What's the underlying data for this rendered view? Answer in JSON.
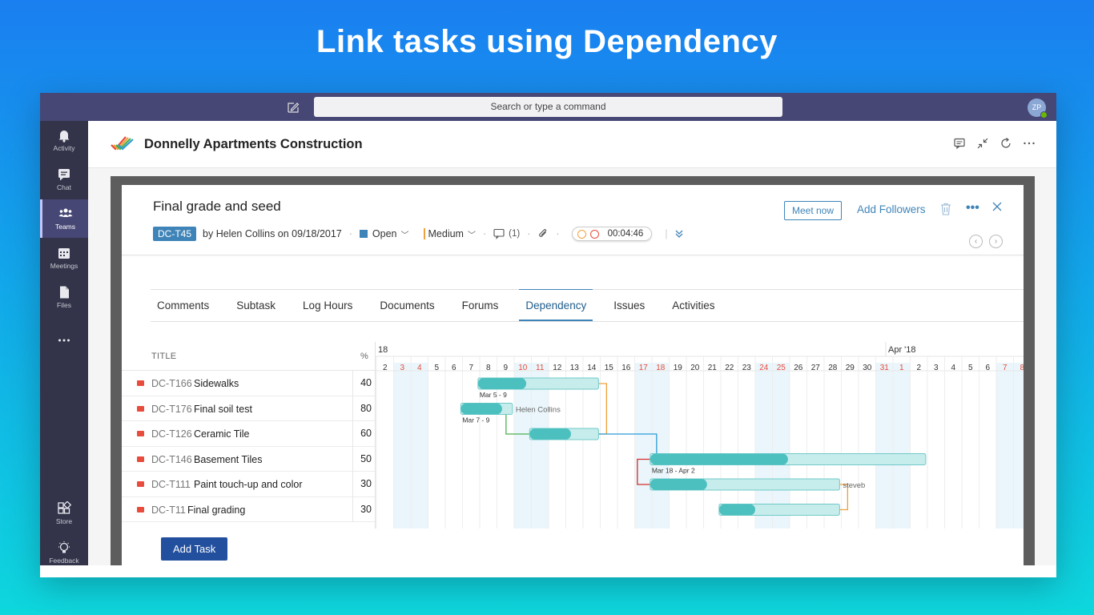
{
  "headline": "Link tasks using Dependency",
  "titlebar": {
    "search_placeholder": "Search or type a command",
    "avatar_initials": "ZP"
  },
  "rail": [
    {
      "label": "Activity",
      "icon": "bell-icon",
      "active": false
    },
    {
      "label": "Chat",
      "icon": "chat-icon",
      "active": false
    },
    {
      "label": "Teams",
      "icon": "teams-icon",
      "active": true
    },
    {
      "label": "Meetings",
      "icon": "calendar-icon",
      "active": false
    },
    {
      "label": "Files",
      "icon": "file-icon",
      "active": false
    },
    {
      "label": "Store",
      "icon": "store-icon",
      "active": false
    },
    {
      "label": "Feedback",
      "icon": "lightbulb-icon",
      "active": false
    }
  ],
  "app": {
    "title": "Donnelly Apartments Construction"
  },
  "task": {
    "title": "Final grade and seed",
    "id": "DC-T45",
    "created": "by Helen Collins on 09/18/2017",
    "status": "Open",
    "priority": "Medium",
    "comments": "(1)",
    "timer": "00:04:46",
    "meet_now": "Meet now",
    "add_followers": "Add Followers"
  },
  "tabs": [
    "Comments",
    "Subtask",
    "Log Hours",
    "Documents",
    "Forums",
    "Dependency",
    "Issues",
    "Activities"
  ],
  "active_tab": "Dependency",
  "tasklist": {
    "title_header": "TITLE",
    "pct_header": "%",
    "rows": [
      {
        "code": "DC-T166",
        "name": "Sidewalks",
        "pct": "40"
      },
      {
        "code": "DC-T176",
        "name": "Final soil test",
        "pct": "80"
      },
      {
        "code": "DC-T126",
        "name": "Ceramic Tile",
        "pct": "60"
      },
      {
        "code": "DC-T146",
        "name": "Basement Tiles",
        "pct": "50"
      },
      {
        "code": "DC-T111",
        "name": "Paint touch-up and color",
        "pct": "30"
      },
      {
        "code": "DC-T11",
        "name": "Final grading",
        "pct": "30"
      }
    ]
  },
  "gantt": {
    "month_labels": [
      {
        "text": "18",
        "day_index": 0
      },
      {
        "text": "Apr '18",
        "day_index": 30
      }
    ],
    "days": [
      "2",
      "3",
      "4",
      "5",
      "6",
      "7",
      "8",
      "9",
      "10",
      "11",
      "12",
      "13",
      "14",
      "15",
      "16",
      "17",
      "18",
      "19",
      "20",
      "21",
      "22",
      "23",
      "24",
      "25",
      "26",
      "27",
      "28",
      "29",
      "30",
      "31",
      "1",
      "2",
      "3",
      "4",
      "5",
      "6",
      "7",
      "8"
    ],
    "weekend_indexes": [
      1,
      2,
      8,
      9,
      15,
      16,
      22,
      23,
      29,
      30,
      36,
      37
    ],
    "bars": [
      {
        "row": 0,
        "start": 5.9,
        "end": 12.9,
        "progress": 0.4,
        "label": "Mar 5 - 9",
        "side": ""
      },
      {
        "row": 1,
        "start": 4.9,
        "end": 7.9,
        "progress": 0.8,
        "label": "Mar 7 - 9",
        "side": "Helen Collins"
      },
      {
        "row": 2,
        "start": 8.9,
        "end": 12.9,
        "progress": 0.6,
        "label": "",
        "side": ""
      },
      {
        "row": 3,
        "start": 15.9,
        "end": 31.9,
        "progress": 0.5,
        "label": "Mar 18 - Apr 2",
        "side": ""
      },
      {
        "row": 4,
        "start": 15.9,
        "end": 26.9,
        "progress": 0.3,
        "label": "",
        "side": "steveb"
      },
      {
        "row": 5,
        "start": 19.9,
        "end": 26.9,
        "progress": 0.3,
        "label": "",
        "side": ""
      }
    ],
    "links": [
      {
        "from": 0,
        "to": 2,
        "color": "#f0a13c"
      },
      {
        "from": 1,
        "to": 2,
        "color": "#4caf50"
      },
      {
        "from": 2,
        "to": 3,
        "color": "#2b9bd8"
      },
      {
        "from": 3,
        "to": 4,
        "color": "#d32f2f"
      },
      {
        "from": 4,
        "to": 5,
        "color": "#f0a13c"
      }
    ]
  },
  "add_task_label": "Add Task"
}
